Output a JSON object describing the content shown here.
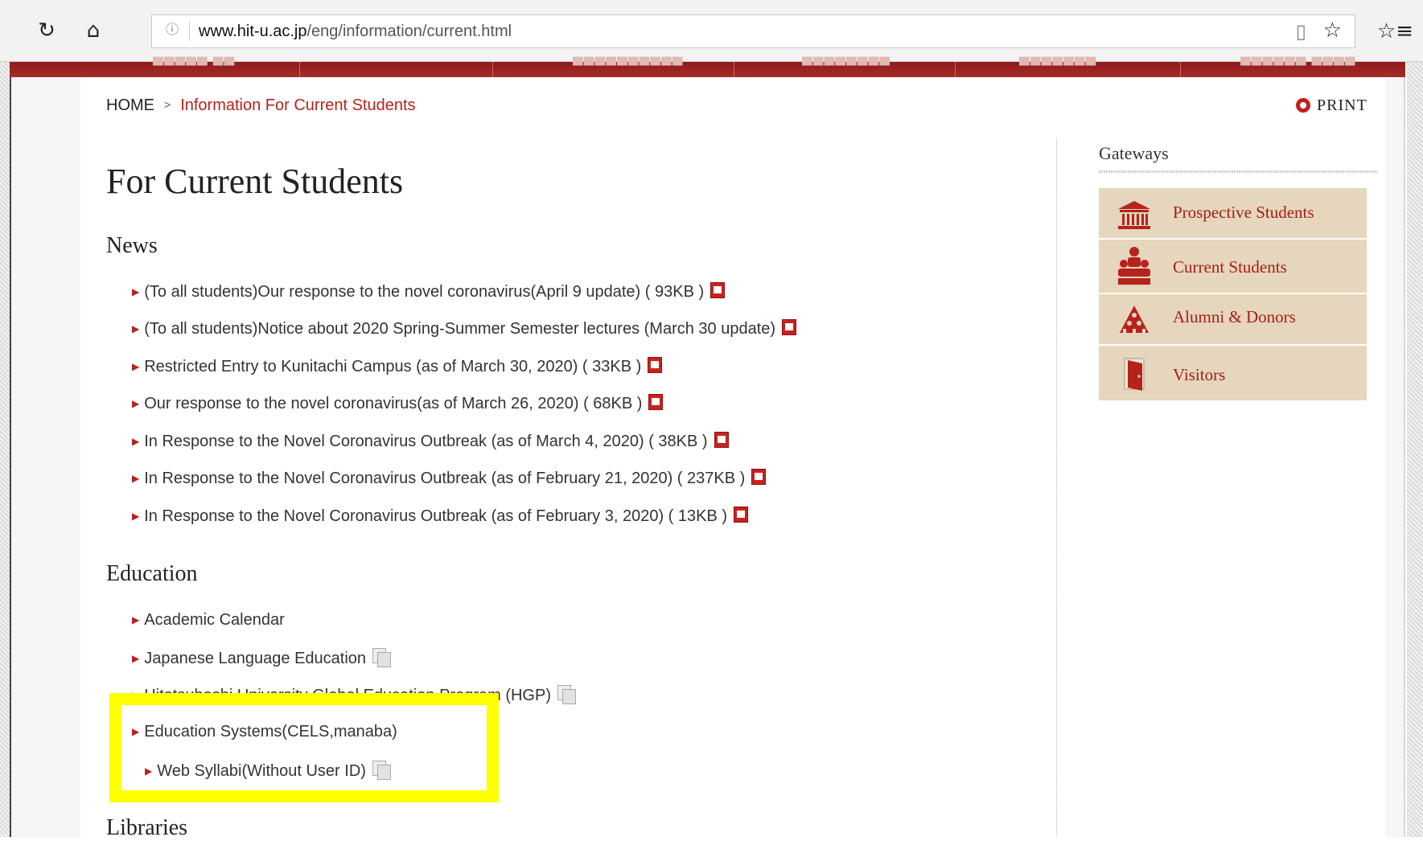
{
  "browser": {
    "url_domain": "www.hit-u.ac.jp",
    "url_path": "/eng/information/current.html",
    "refresh_icon": "refresh-icon",
    "home_icon": "home-icon",
    "info_icon": "info-icon",
    "reader_icon": "reading-view-icon",
    "favorite_icon": "star-icon",
    "favorites_bar_icon": "favorites-list-icon"
  },
  "breadcrumb": {
    "home": "HOME",
    "separator": ">",
    "current": "Information For Current Students"
  },
  "print": {
    "label": "PRINT"
  },
  "page_title": "For Current Students",
  "news": {
    "heading": "News",
    "items": [
      {
        "text": "(To all students)Our response to the novel coronavirus(April 9 update) ( 93KB )",
        "icon": "pdf-icon"
      },
      {
        "text": "(To all students)Notice about 2020 Spring-Summer Semester lectures (March 30 update)",
        "icon": "pdf-icon"
      },
      {
        "text": "Restricted Entry to Kunitachi Campus (as of March 30, 2020) ( 33KB )",
        "icon": "pdf-icon"
      },
      {
        "text": "Our response to the novel coronavirus(as of March 26, 2020) ( 68KB )",
        "icon": "pdf-icon"
      },
      {
        "text": "In Response to the Novel Coronavirus Outbreak (as of March 4, 2020) ( 38KB )",
        "icon": "pdf-icon"
      },
      {
        "text": "In Response to the Novel Coronavirus Outbreak (as of February 21, 2020) ( 237KB )",
        "icon": "pdf-icon"
      },
      {
        "text": "In Response to the Novel Coronavirus Outbreak (as of February 3, 2020) ( 13KB )",
        "icon": "pdf-icon"
      }
    ]
  },
  "education": {
    "heading": "Education",
    "items": [
      {
        "text": "Academic Calendar"
      },
      {
        "text": "Japanese Language Education",
        "icon": "external-window-icon"
      },
      {
        "text": "Hitotsubashi University Global Education Program (HGP)",
        "icon": "external-window-icon"
      },
      {
        "text": "Education Systems(CELS,manaba)"
      },
      {
        "text": "Web Syllabi(Without User ID)",
        "icon": "external-window-icon"
      }
    ]
  },
  "libraries": {
    "heading": "Libraries"
  },
  "sidebar": {
    "title": "Gateways",
    "items": [
      {
        "label": "Prospective Students",
        "icon": "building-icon"
      },
      {
        "label": "Current Students",
        "icon": "students-icon"
      },
      {
        "label": "Alumni & Donors",
        "icon": "people-pyramid-icon"
      },
      {
        "label": "Visitors",
        "icon": "door-icon"
      }
    ]
  },
  "colors": {
    "accent": "#b5231c",
    "nav_bar": "#9a2421",
    "sidebar_bg": "#e5d6bd",
    "highlight": "#ffff00"
  }
}
